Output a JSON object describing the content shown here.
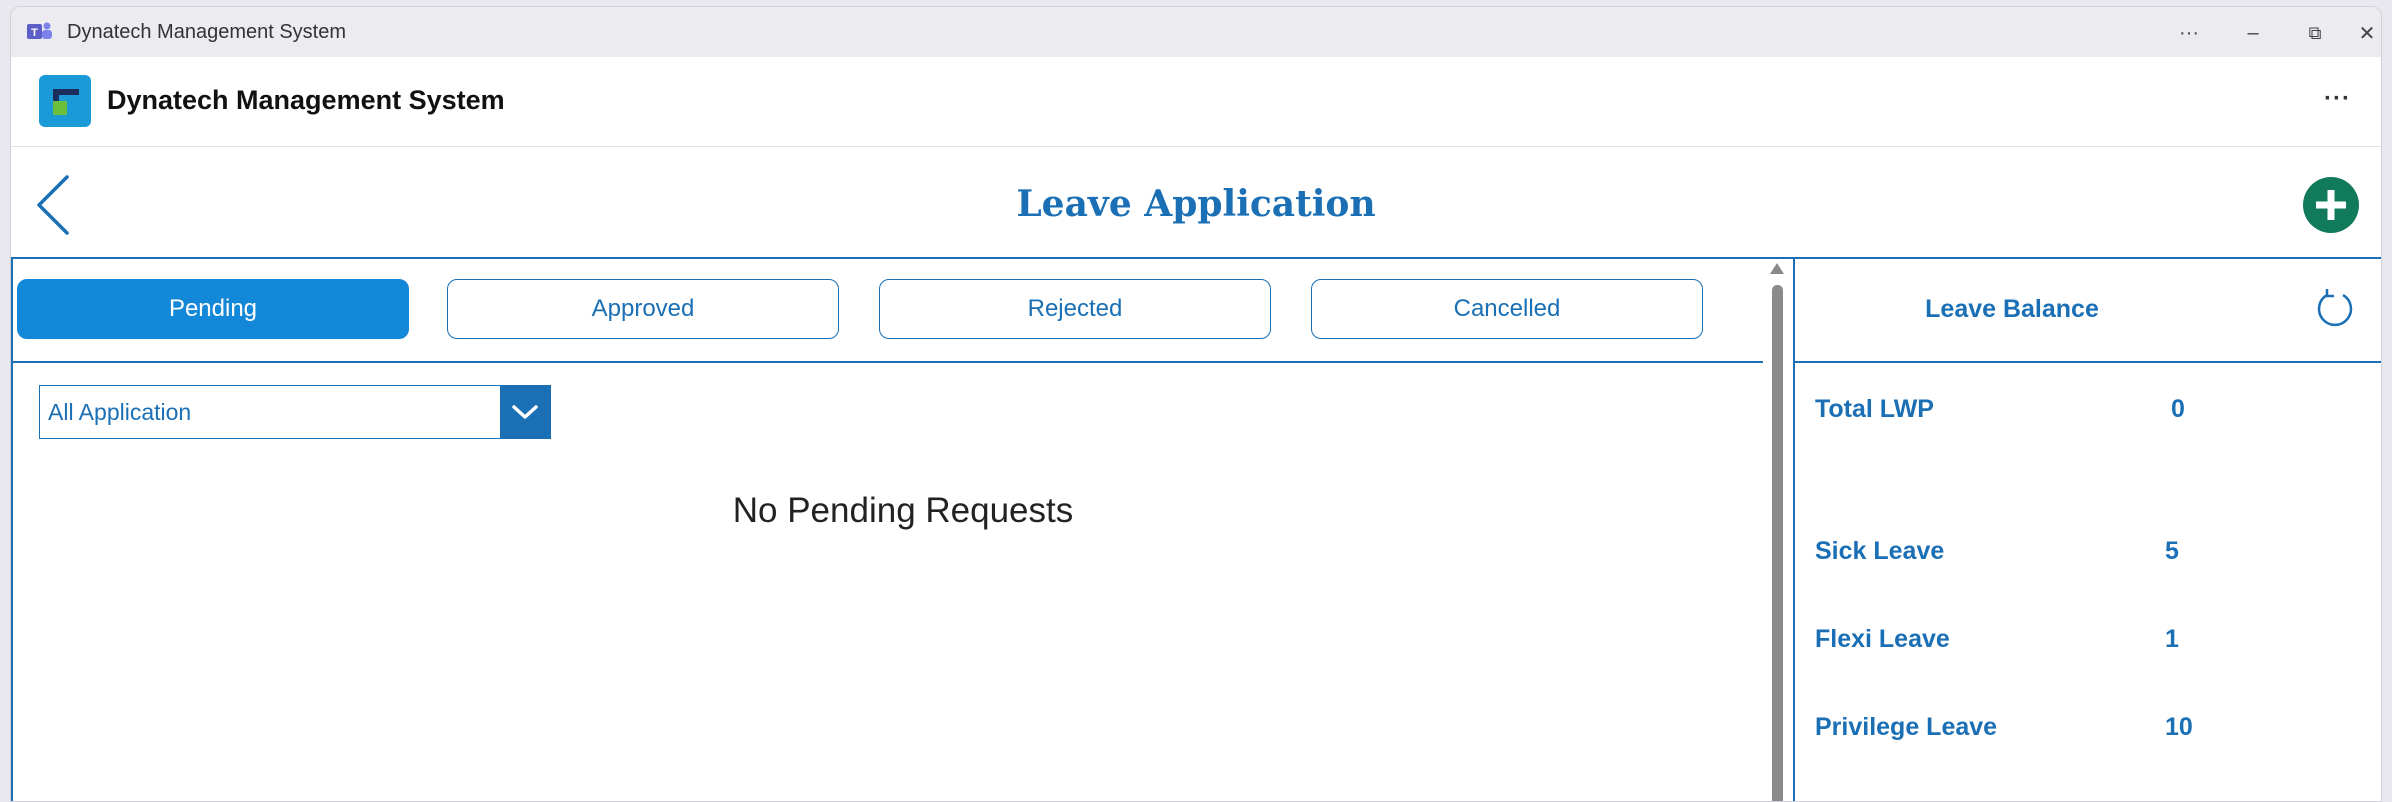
{
  "window": {
    "title": "Dynatech Management System",
    "controls": {
      "more": "···",
      "minimize": "–",
      "restore": "⧉",
      "close": "✕"
    }
  },
  "app": {
    "title": "Dynatech Management System",
    "more": "···"
  },
  "page": {
    "title": "Leave Application",
    "back_icon": "chevron-left-icon",
    "add_icon": "plus-icon"
  },
  "tabs": [
    {
      "label": "Pending",
      "active": true
    },
    {
      "label": "Approved",
      "active": false
    },
    {
      "label": "Rejected",
      "active": false
    },
    {
      "label": "Cancelled",
      "active": false
    }
  ],
  "filter": {
    "selected": "All Application",
    "icon": "chevron-down-icon"
  },
  "main": {
    "empty_message": "No Pending Requests"
  },
  "balance": {
    "title": "Leave Balance",
    "refresh_icon": "refresh-icon",
    "rows": [
      {
        "label": "Total LWP",
        "value": "0"
      },
      {
        "label": "Sick Leave",
        "value": "5"
      },
      {
        "label": "Flexi Leave",
        "value": "1"
      },
      {
        "label": "Privilege Leave",
        "value": "10"
      }
    ]
  },
  "colors": {
    "accent": "#1a6fb5",
    "tab_active": "#1488d8",
    "add_button": "#117a5a",
    "logo": "#1a9ad6"
  }
}
